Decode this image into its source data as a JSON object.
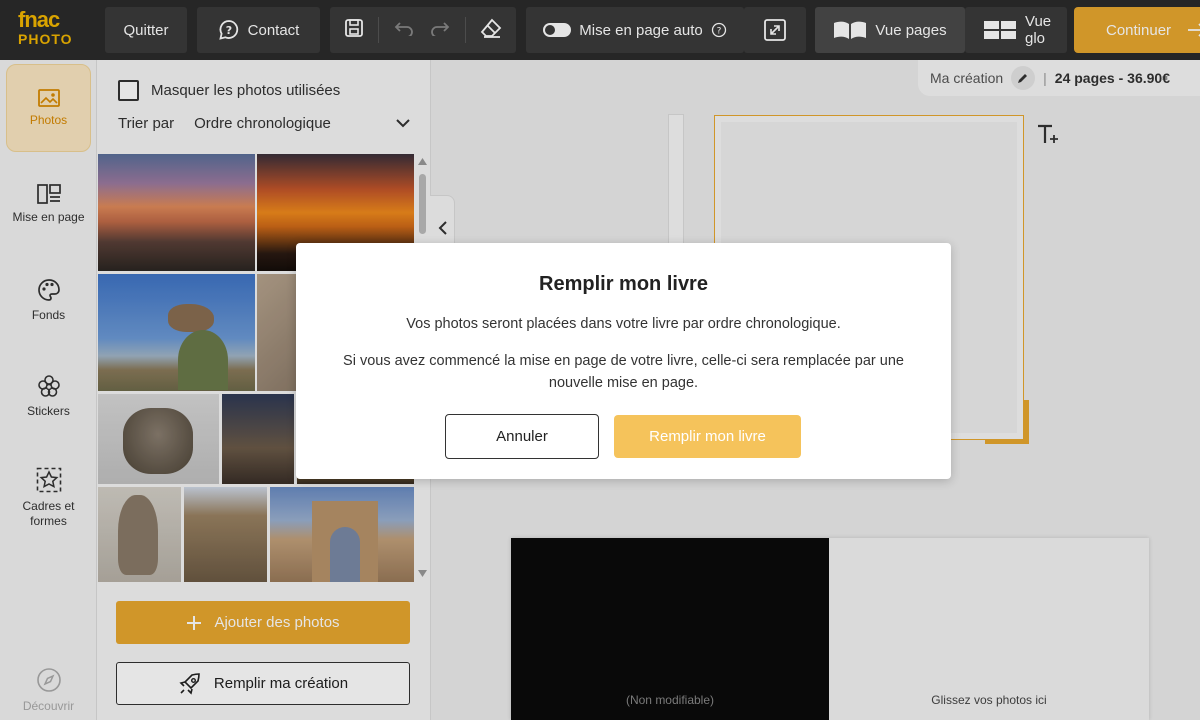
{
  "brand": {
    "line1": "fnac",
    "line2": "PHOTO"
  },
  "toolbar": {
    "quit_label": "Quitter",
    "contact_label": "Contact",
    "auto_layout_label": "Mise en page auto",
    "view_pages_label": "Vue pages",
    "view_global_label": "Vue glo",
    "continue_label": "Continuer"
  },
  "sidebar": {
    "items": [
      {
        "label": "Photos"
      },
      {
        "label": "Mise en page"
      },
      {
        "label": "Fonds"
      },
      {
        "label": "Stickers"
      },
      {
        "label": "Cadres et\nformes"
      },
      {
        "label": "Découvrir"
      }
    ]
  },
  "photos_panel": {
    "hide_used_label": "Masquer les photos utilisées",
    "sort_label": "Trier par",
    "sort_value": "Ordre chronologique",
    "add_photos_label": "Ajouter des photos",
    "fill_creation_label": "Remplir ma création"
  },
  "creation": {
    "name": "Ma création",
    "meta": "24 pages - 36.90€"
  },
  "spread": {
    "left_label": "(Non modifiable)",
    "right_label": "Glissez vos photos ici"
  },
  "modal": {
    "title": "Remplir mon livre",
    "line1": "Vos photos seront placées dans votre livre par ordre chronologique.",
    "line2": "Si vous avez commencé la mise en page de votre livre, celle-ci sera remplacée par une nouvelle mise en page.",
    "cancel_label": "Annuler",
    "confirm_label": "Remplir mon livre"
  },
  "colors": {
    "accent": "#e8a72e",
    "accent_light": "#f5c35b",
    "topbar": "#2b2b2b"
  }
}
